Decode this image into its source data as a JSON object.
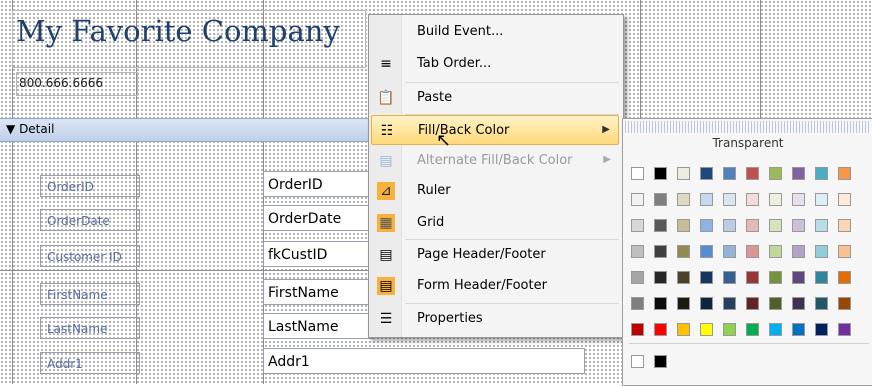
{
  "report": {
    "title": "My Favorite Company",
    "phone": "800.666.6666",
    "section": "Detail",
    "section_icon": "section-arrow-icon",
    "rows": [
      {
        "label": "OrderID",
        "field": "OrderID"
      },
      {
        "label": "OrderDate",
        "field": "OrderDate"
      },
      {
        "label": "Customer ID",
        "field": "fkCustID"
      },
      {
        "label": "FirstName",
        "field": "FirstName"
      },
      {
        "label": "LastName",
        "field": "LastName"
      },
      {
        "label": "Addr1",
        "field": "Addr1"
      }
    ]
  },
  "context_menu": {
    "items": [
      {
        "label": "Build Event...",
        "icon": "build-event-icon"
      },
      {
        "label": "Tab Order...",
        "icon": "tab-order-icon"
      },
      {
        "label": "Paste",
        "icon": "paste-icon"
      },
      {
        "label": "Fill/Back Color",
        "icon": "fill-back-color-icon",
        "highlighted": true,
        "submenu": true
      },
      {
        "label": "Alternate Fill/Back Color",
        "icon": "alternate-fill-icon",
        "disabled": true,
        "submenu": true
      },
      {
        "label": "Ruler",
        "icon": "ruler-icon"
      },
      {
        "label": "Grid",
        "icon": "grid-icon"
      },
      {
        "label": "Page Header/Footer",
        "icon": "page-header-footer-icon"
      },
      {
        "label": "Form Header/Footer",
        "icon": "form-header-footer-icon"
      },
      {
        "label": "Properties",
        "icon": "properties-icon"
      }
    ]
  },
  "color_palette": {
    "transparent_label": "Transparent",
    "rows": [
      [
        "#ffffff",
        "#000000",
        "#eeece1",
        "#1f497d",
        "#4f81bd",
        "#c0504d",
        "#9bbb59",
        "#8064a2",
        "#4bacc6",
        "#f79646"
      ],
      [
        "#f2f2f2",
        "#7f7f7f",
        "#ddd9c3",
        "#c6d9f0",
        "#dbe5f1",
        "#f2dcdb",
        "#ebf1dd",
        "#e5e0ec",
        "#dbeef3",
        "#fdeada"
      ],
      [
        "#d8d8d8",
        "#595959",
        "#c4bd97",
        "#8db3e2",
        "#b8cce4",
        "#e5b9b7",
        "#d7e3bc",
        "#ccc1d9",
        "#b7dde8",
        "#fbd5b5"
      ],
      [
        "#bfbfbf",
        "#3f3f3f",
        "#938953",
        "#548dd4",
        "#95b3d7",
        "#d99694",
        "#c3d69b",
        "#b2a2c7",
        "#92cddc",
        "#fac08f"
      ],
      [
        "#a5a5a5",
        "#262626",
        "#494429",
        "#17365d",
        "#366092",
        "#953734",
        "#76923c",
        "#5f497a",
        "#31859b",
        "#e36c09"
      ],
      [
        "#7f7f7f",
        "#0c0c0c",
        "#1d1b10",
        "#0f243e",
        "#244061",
        "#632423",
        "#4f6128",
        "#3f3151",
        "#205867",
        "#974806"
      ],
      [
        "#c00000",
        "#ff0000",
        "#ffc000",
        "#ffff00",
        "#92d050",
        "#00b050",
        "#00b0f0",
        "#0070c0",
        "#002060",
        "#7030a0"
      ]
    ],
    "recent": [
      "#ffffff",
      "#000000"
    ]
  }
}
